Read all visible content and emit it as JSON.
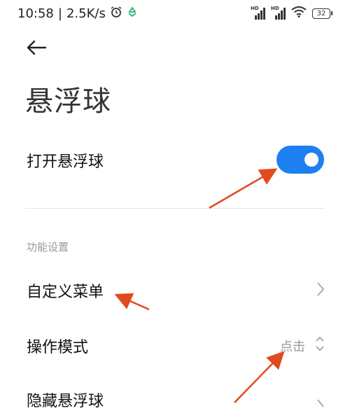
{
  "status_bar": {
    "time": "10:58",
    "separator": "|",
    "net_speed": "2.5K/s",
    "signal1_label": "HD",
    "signal2_label": "HD",
    "battery": "32"
  },
  "page": {
    "title": "悬浮球"
  },
  "toggle_row": {
    "label": "打开悬浮球",
    "enabled": true
  },
  "section": {
    "header": "功能设置"
  },
  "items": [
    {
      "label": "自定义菜单"
    },
    {
      "label": "操作模式",
      "value": "点击"
    },
    {
      "label": "隐藏悬浮球"
    }
  ],
  "colors": {
    "accent": "#1e7ff0",
    "annotation_arrow": "#e04a1f",
    "secondary_text": "#999999"
  }
}
